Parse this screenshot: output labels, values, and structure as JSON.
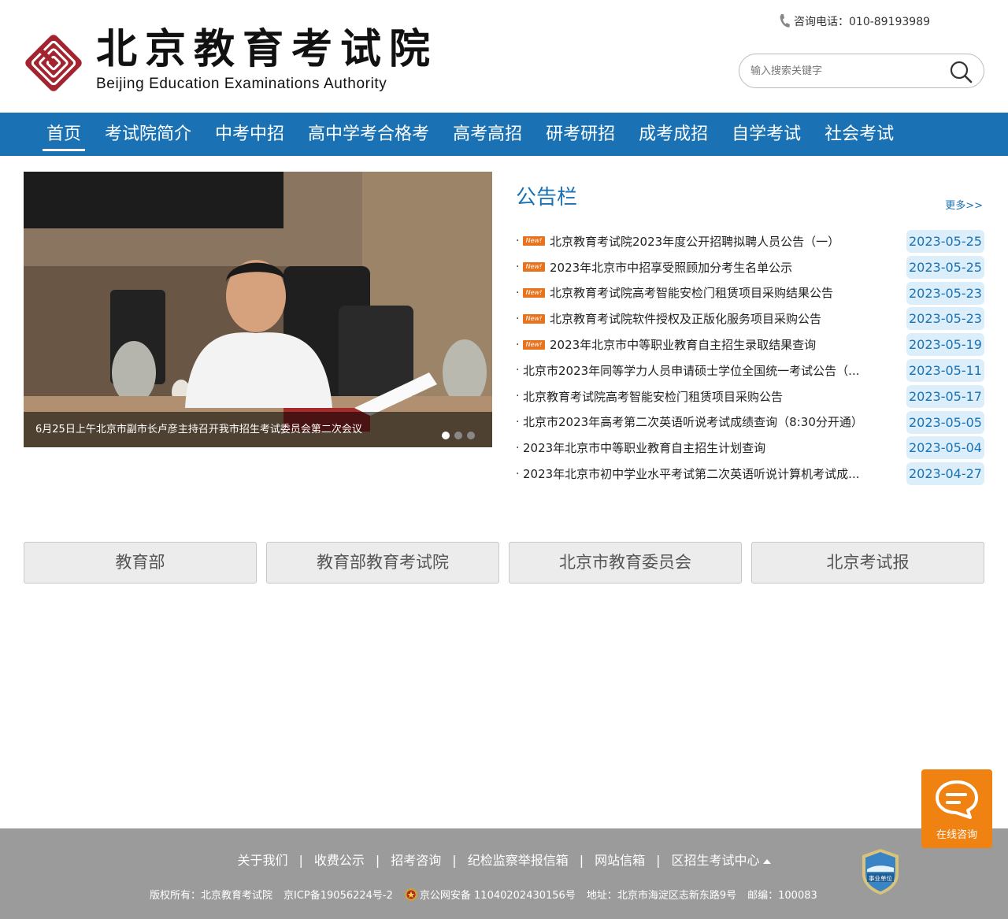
{
  "header": {
    "logo_cn": "北京教育考试院",
    "logo_en": "Beijing Education Examinations Authority",
    "hotline": "咨询电话：010-89193989",
    "search_placeholder": "输入搜索关键字"
  },
  "nav": {
    "items": [
      "首页",
      "考试院简介",
      "中考中招",
      "高中学考合格考",
      "高考高招",
      "研考研招",
      "成考成招",
      "自学考试",
      "社会考试"
    ],
    "active_index": 0
  },
  "banner": {
    "caption": "6月25日上午北京市副市长卢彦主持召开我市招生考试委员会第二次会议",
    "slide_count": 3,
    "active_slide": 1
  },
  "notice": {
    "title": "公告栏",
    "more": "更多>>",
    "badge_text": "New!",
    "items": [
      {
        "title": "北京教育考试院2023年度公开招聘拟聘人员公告（一）",
        "date": "2023-05-25",
        "is_new": true
      },
      {
        "title": "2023年北京市中招享受照顾加分考生名单公示",
        "date": "2023-05-25",
        "is_new": true
      },
      {
        "title": "北京教育考试院高考智能安检门租赁项目采购结果公告",
        "date": "2023-05-23",
        "is_new": true
      },
      {
        "title": "北京教育考试院软件授权及正版化服务项目采购公告",
        "date": "2023-05-23",
        "is_new": true
      },
      {
        "title": "2023年北京市中等职业教育自主招生录取结果查询",
        "date": "2023-05-19",
        "is_new": true
      },
      {
        "title": "北京市2023年同等学力人员申请硕士学位全国统一考试公告（...",
        "date": "2023-05-11",
        "is_new": false
      },
      {
        "title": "北京教育考试院高考智能安检门租赁项目采购公告",
        "date": "2023-05-17",
        "is_new": false
      },
      {
        "title": "北京市2023年高考第二次英语听说考试成绩查询（8:30分开通）",
        "date": "2023-05-05",
        "is_new": false
      },
      {
        "title": "2023年北京市中等职业教育自主招生计划查询",
        "date": "2023-05-04",
        "is_new": false
      },
      {
        "title": "2023年北京市初中学业水平考试第二次英语听说计算机考试成...",
        "date": "2023-04-27",
        "is_new": false
      }
    ]
  },
  "links": [
    "教育部",
    "教育部教育考试院",
    "北京市教育委员会",
    "北京考试报"
  ],
  "chat": {
    "label": "在线咨询"
  },
  "footer": {
    "links": [
      "关于我们",
      "收费公示",
      "招考咨询",
      "纪检监察举报信箱",
      "网站信箱",
      "区招生考试中心"
    ],
    "separator": "|",
    "copyright": "版权所有：北京教育考试院",
    "icp": "京ICP备19056224号-2",
    "police": "京公网安备 11040202430156号",
    "address": "地址：北京市海淀区志新东路9号",
    "postcode": "邮编：100083",
    "badge_text": "事业单位"
  },
  "colors": {
    "brand_blue": "#1a72b4",
    "logo_red": "#a3232e",
    "new_badge": "#e8731c",
    "chat_orange": "#f08212",
    "footer_gray": "#9b9b9b",
    "date_bg": "#dceefa"
  },
  "icons": [
    "phone-icon",
    "search-icon",
    "chat-bubble-icon",
    "police-badge-icon",
    "gov-unit-badge-icon",
    "logo-emblem-icon"
  ]
}
